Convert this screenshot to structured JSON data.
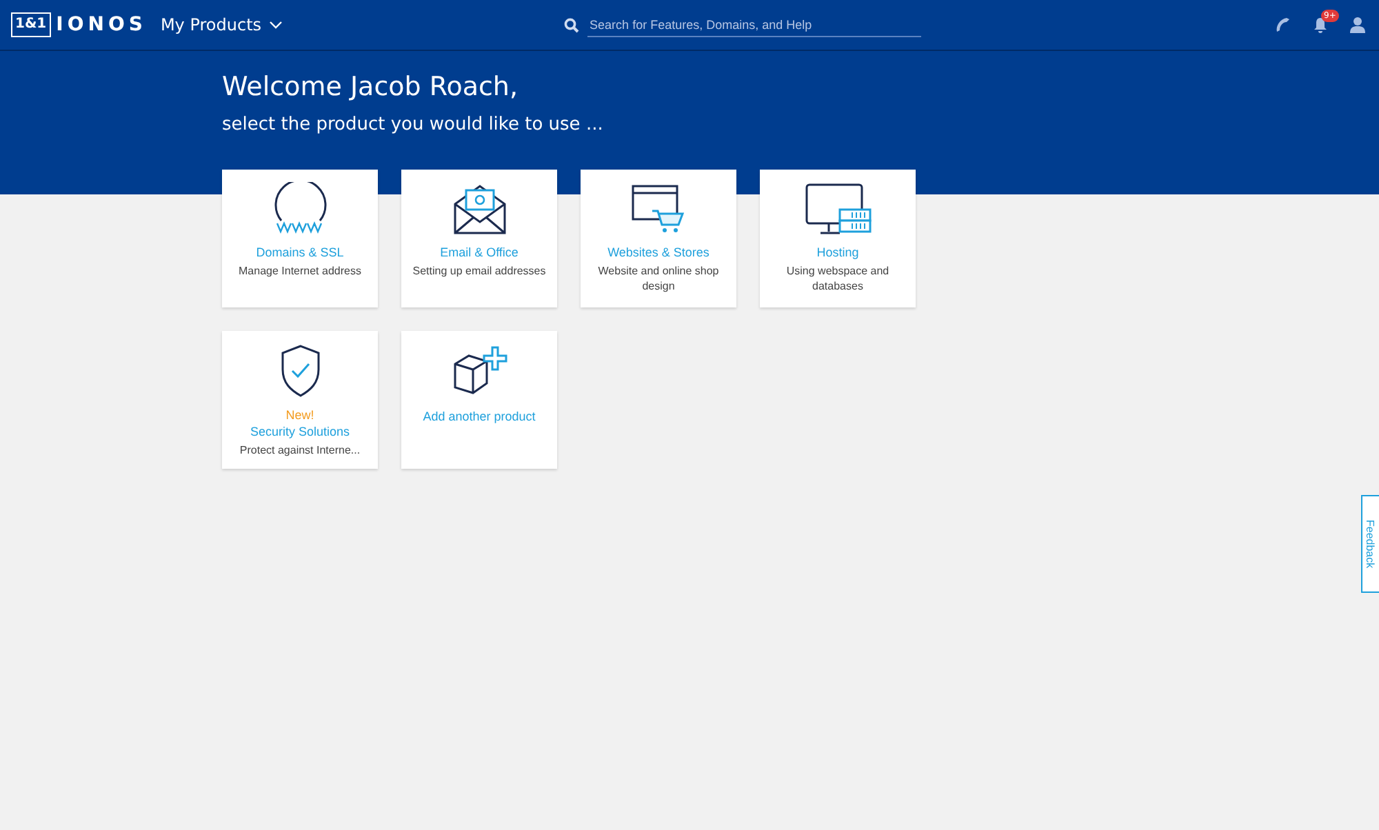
{
  "header": {
    "logo_badge": "1&1",
    "logo_text": "IONOS",
    "menu": "My Products",
    "search": {
      "placeholder": "Search for Features, Domains, and Help"
    },
    "notification_badge": "9+"
  },
  "welcome": {
    "title": "Welcome Jacob Roach,",
    "subtitle": "select the product you would like to use ..."
  },
  "products": [
    {
      "kind": "domains",
      "title": "Domains & SSL",
      "description": "Manage Internet address"
    },
    {
      "kind": "email",
      "title": "Email & Office",
      "description": "Setting up email addresses"
    },
    {
      "kind": "websites",
      "title": "Websites & Stores",
      "description": "Website and online shop design"
    },
    {
      "kind": "hosting",
      "title": "Hosting",
      "description": "Using webspace and databases"
    },
    {
      "kind": "security",
      "badge": "New!",
      "title": "Security Solutions",
      "description": "Protect against Interne..."
    },
    {
      "kind": "add",
      "title": "Add another product"
    }
  ],
  "feedback_tab": "Feedback"
}
